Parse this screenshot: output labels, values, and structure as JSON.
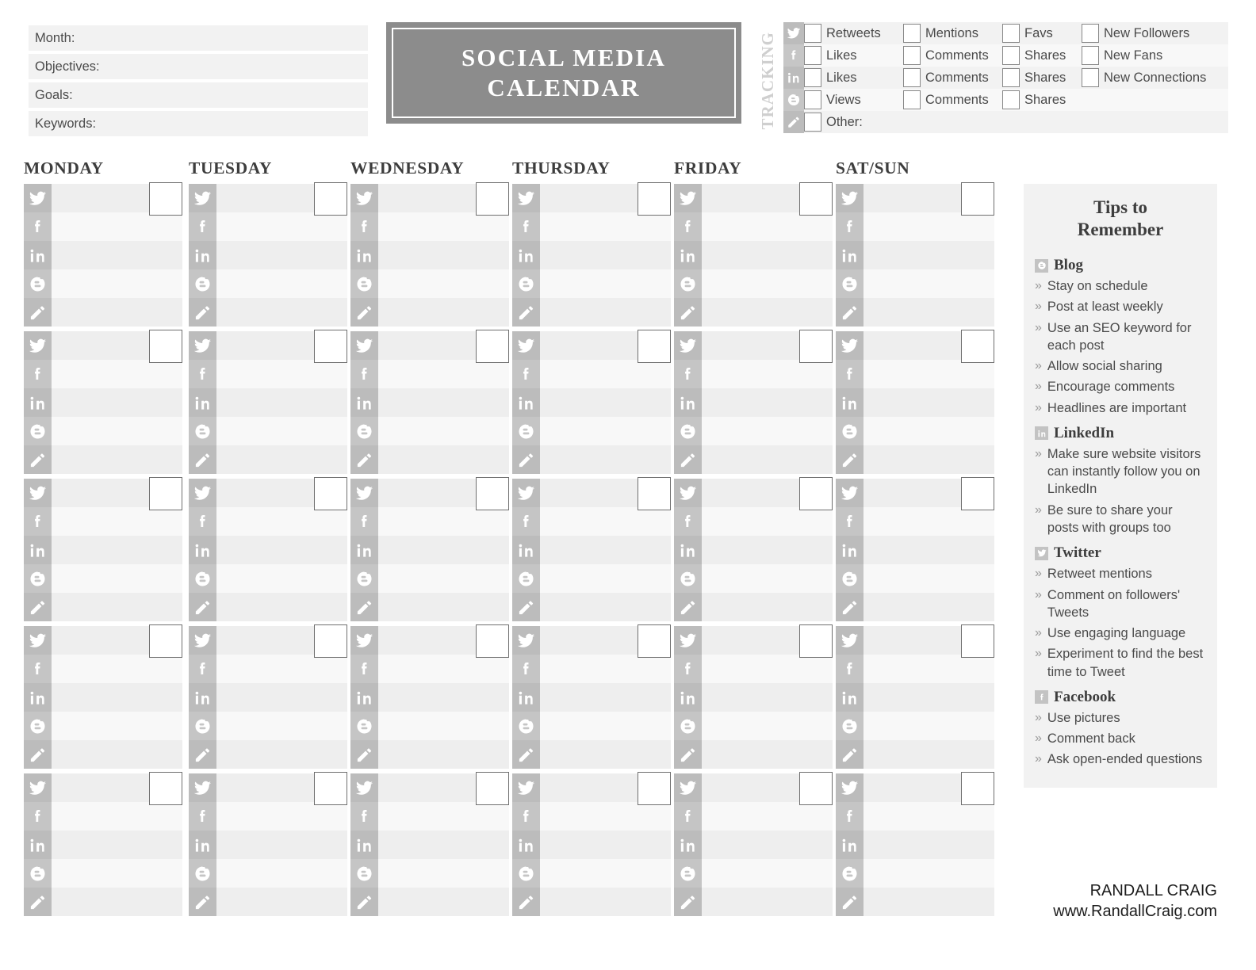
{
  "header": {
    "title_line1": "SOCIAL MEDIA",
    "title_line2": "CALENDAR",
    "fields": [
      {
        "label": "Month:",
        "value": ""
      },
      {
        "label": "Objectives:",
        "value": ""
      },
      {
        "label": "Goals:",
        "value": ""
      },
      {
        "label": "Keywords:",
        "value": ""
      }
    ]
  },
  "tracking": {
    "label": "TRACKING",
    "rows": [
      {
        "platform": "twitter",
        "items": [
          "Retweets",
          "Mentions",
          "Favs",
          "New Followers"
        ]
      },
      {
        "platform": "facebook",
        "items": [
          "Likes",
          "Comments",
          "Shares",
          "New Fans"
        ]
      },
      {
        "platform": "linkedin",
        "items": [
          "Likes",
          "Comments",
          "Shares",
          "New Connections"
        ]
      },
      {
        "platform": "blogger",
        "items": [
          "Views",
          "Comments",
          "Shares"
        ]
      },
      {
        "platform": "pencil",
        "items": [
          "Other:"
        ]
      }
    ]
  },
  "calendar": {
    "days": [
      "MONDAY",
      "TUESDAY",
      "WEDNESDAY",
      "THURSDAY",
      "FRIDAY",
      "SAT/SUN"
    ],
    "platform_rows": [
      "twitter",
      "facebook",
      "linkedin",
      "blogger",
      "pencil"
    ],
    "weeks": 5,
    "date_values": [
      "",
      "",
      "",
      "",
      "",
      ""
    ]
  },
  "tips": {
    "title_line1": "Tips to",
    "title_line2": "Remember",
    "sections": [
      {
        "icon": "blogger",
        "name": "Blog",
        "items": [
          "Stay on schedule",
          "Post at least weekly",
          "Use an SEO keyword for each post",
          "Allow social sharing",
          "Encourage comments",
          "Headlines are important"
        ]
      },
      {
        "icon": "linkedin",
        "name": "LinkedIn",
        "items": [
          "Make sure website visitors can instantly follow you on LinkedIn",
          "Be sure to share your posts with groups too"
        ]
      },
      {
        "icon": "twitter",
        "name": "Twitter",
        "items": [
          "Retweet mentions",
          "Comment on followers' Tweets",
          "Use engaging language",
          "Experiment to find the best time to Tweet"
        ]
      },
      {
        "icon": "facebook",
        "name": "Facebook",
        "items": [
          "Use pictures",
          "Comment back",
          "Ask open-ended questions"
        ]
      }
    ],
    "bullet": "»"
  },
  "footer": {
    "name": "RANDALL CRAIG",
    "site": "www.RandallCraig.com"
  },
  "colors": {
    "title_bg": "#8c8c8c",
    "icon_strip": "#bcbcbc",
    "row_light": "#f8f8f8",
    "row_dark": "#eeeeee",
    "panel_bg": "#f2f2f2"
  }
}
